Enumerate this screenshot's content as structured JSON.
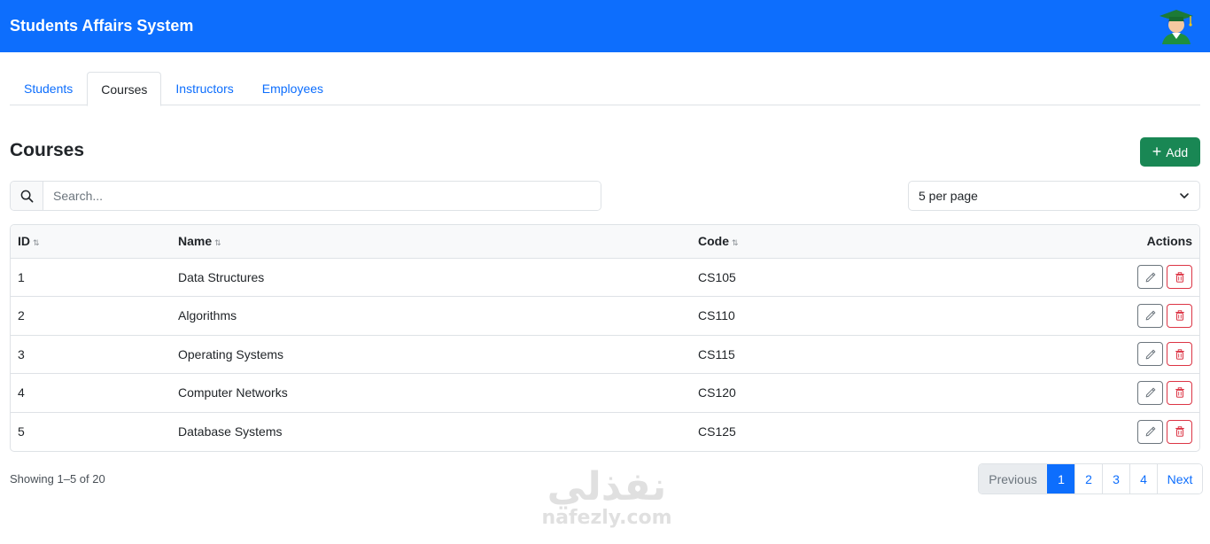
{
  "header": {
    "brand": "Students Affairs System"
  },
  "tabs": [
    {
      "label": "Students",
      "active": false
    },
    {
      "label": "Courses",
      "active": true
    },
    {
      "label": "Instructors",
      "active": false
    },
    {
      "label": "Employees",
      "active": false
    }
  ],
  "page": {
    "title": "Courses",
    "add_label": "Add"
  },
  "search": {
    "placeholder": "Search...",
    "value": ""
  },
  "per_page": {
    "selected": "5 per page"
  },
  "table": {
    "columns": [
      {
        "label": "ID",
        "sortable": true
      },
      {
        "label": "Name",
        "sortable": true
      },
      {
        "label": "Code",
        "sortable": true
      },
      {
        "label": "Actions",
        "sortable": false
      }
    ],
    "rows": [
      {
        "id": "1",
        "name": "Data Structures",
        "code": "CS105"
      },
      {
        "id": "2",
        "name": "Algorithms",
        "code": "CS110"
      },
      {
        "id": "3",
        "name": "Operating Systems",
        "code": "CS115"
      },
      {
        "id": "4",
        "name": "Computer Networks",
        "code": "CS120"
      },
      {
        "id": "5",
        "name": "Database Systems",
        "code": "CS125"
      }
    ]
  },
  "footer": {
    "showing": "Showing 1–5 of 20"
  },
  "pagination": {
    "previous": "Previous",
    "pages": [
      "1",
      "2",
      "3",
      "4"
    ],
    "active_page": "1",
    "next": "Next"
  },
  "watermark": {
    "arabic": "نفذلي",
    "latin": "nafezly.com"
  },
  "colors": {
    "primary": "#0d6efd",
    "success": "#198754",
    "danger": "#dc3545",
    "secondary": "#6c757d"
  },
  "icons": {
    "avatar": "graduate-avatar-icon",
    "search": "search-icon",
    "add": "plus-icon",
    "dropdown": "chevron-down-icon",
    "edit": "pencil-icon",
    "delete": "trash-icon",
    "sort": "sort-icon"
  }
}
